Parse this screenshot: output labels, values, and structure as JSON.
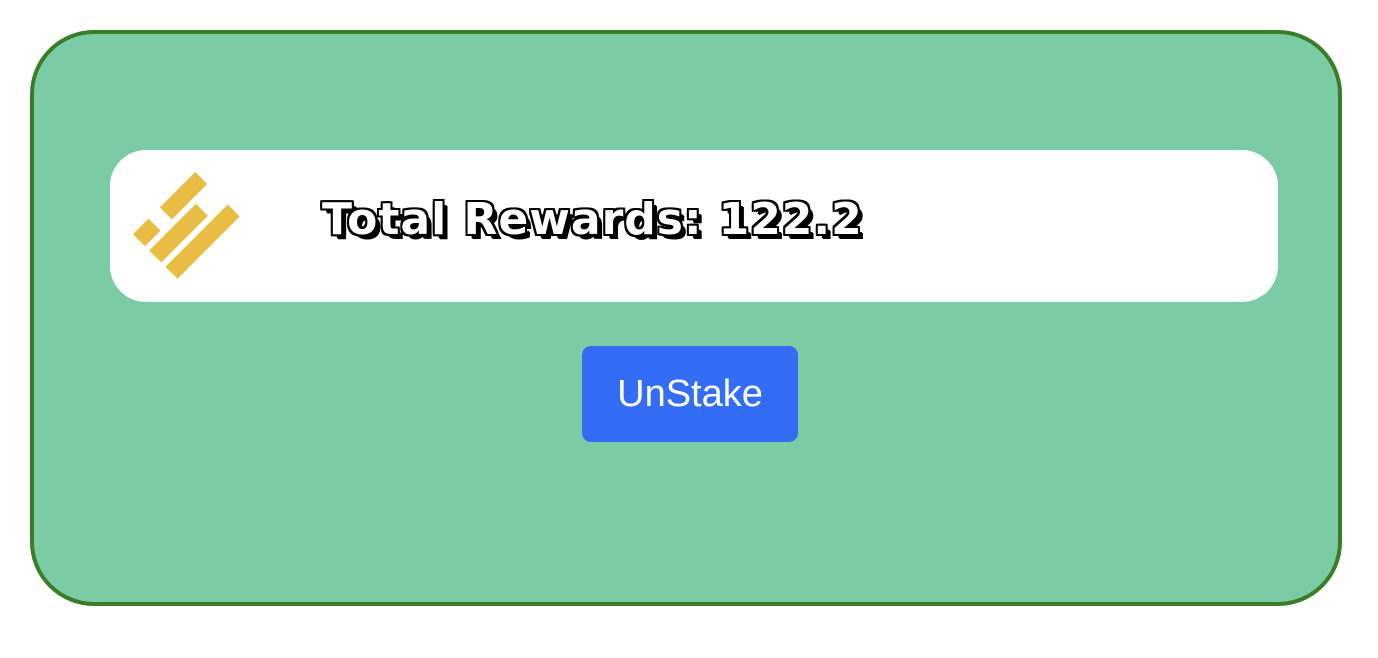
{
  "rewards": {
    "label": "Total Rewards:",
    "value": "122.2"
  },
  "token": {
    "icon": "binance-usd-logo-icon",
    "color": "#e9bc43"
  },
  "actions": {
    "unstake_label": "UnStake"
  },
  "colors": {
    "card_background": "#7bcba5",
    "card_border": "#3a7d27",
    "button_background": "#336df5"
  }
}
